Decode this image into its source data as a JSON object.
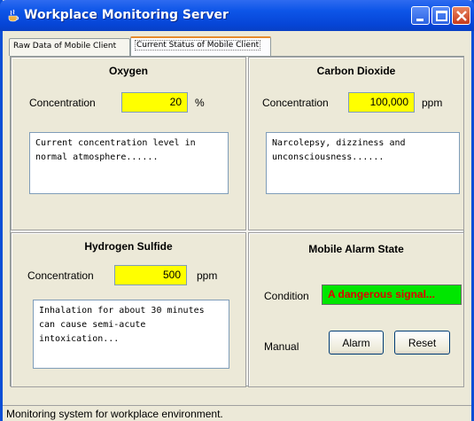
{
  "window": {
    "title": "Workplace Monitoring Server",
    "icon": "java-cup-icon"
  },
  "tabs": [
    {
      "label": "Raw Data of Mobile Client",
      "active": false
    },
    {
      "label": "Current Status of Mobile Client",
      "active": true
    }
  ],
  "oxygen": {
    "title": "Oxygen",
    "concentration_label": "Concentration",
    "value": "20",
    "unit": "%",
    "description": "Current concentration level in\nnormal atmosphere......"
  },
  "carbon_dioxide": {
    "title": "Carbon Dioxide",
    "concentration_label": "Concentration",
    "value": "100,000",
    "unit": "ppm",
    "description": "Narcolepsy, dizziness and\nunconsciousness......"
  },
  "hydrogen_sulfide": {
    "title": "Hydrogen Sulfide",
    "concentration_label": "Concentration",
    "value": "500",
    "unit": "ppm",
    "description": "Inhalation for about 30 minutes\ncan cause semi-acute intoxication..."
  },
  "alarm_state": {
    "title": "Mobile Alarm State",
    "condition_label": "Condition",
    "condition_value": "A dangerous signal...",
    "manual_label": "Manual",
    "alarm_button": "Alarm",
    "reset_button": "Reset"
  },
  "status_bar": {
    "text": "Monitoring system for workplace environment."
  },
  "colors": {
    "title_bar": "#0a4fd6",
    "value_field": "#ffff00",
    "condition_field": "#00e600",
    "condition_text": "#e00000"
  }
}
